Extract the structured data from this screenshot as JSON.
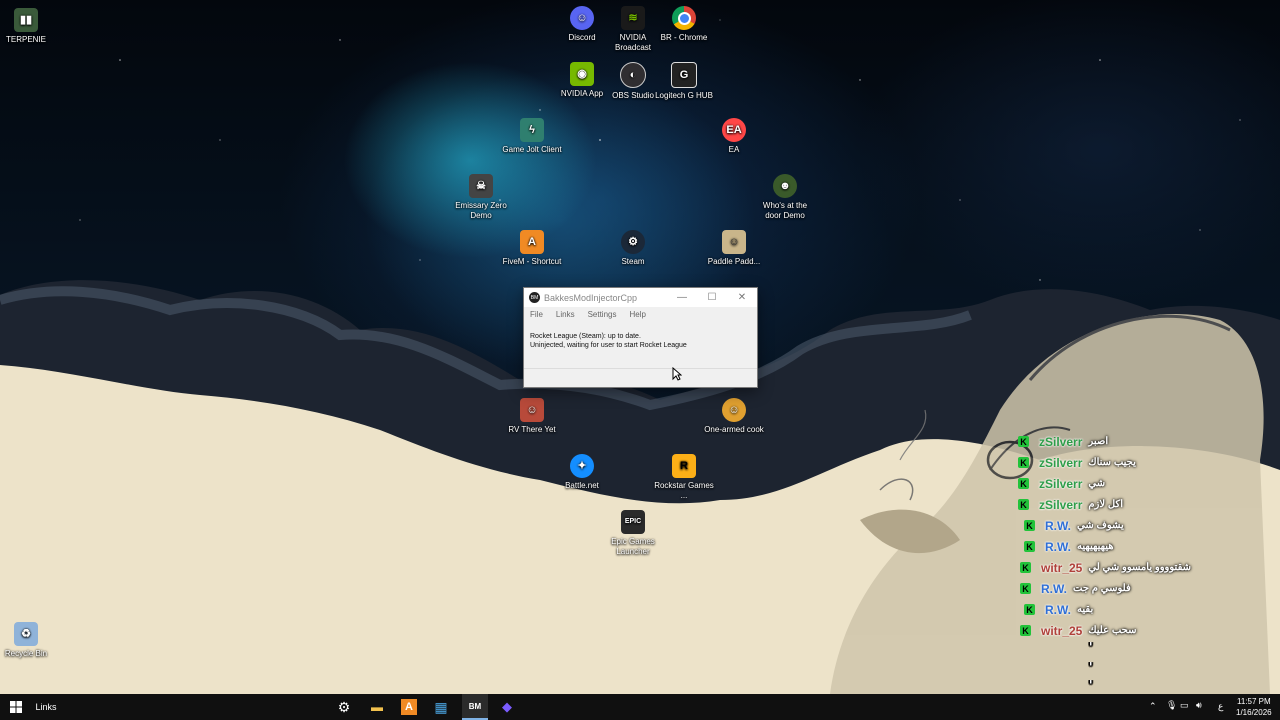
{
  "desktop": {
    "icons": [
      {
        "label": "TERPENIE",
        "icon": "folder-icon",
        "color": "#3a5a3a"
      },
      {
        "label": "Discord",
        "icon": "discord-icon",
        "color": "#5865f2"
      },
      {
        "label": "NVIDIA Broadcast",
        "icon": "nvidia-broadcast-icon",
        "color": "#1a1a1a"
      },
      {
        "label": "BR - Chrome",
        "icon": "chrome-icon",
        "color": "#db4437"
      },
      {
        "label": "NVIDIA App",
        "icon": "nvidia-icon",
        "color": "#76b900"
      },
      {
        "label": "OBS Studio",
        "icon": "obs-icon",
        "color": "#302e31"
      },
      {
        "label": "Logitech G HUB",
        "icon": "logitech-icon",
        "color": "#222222"
      },
      {
        "label": "Game Jolt Client",
        "icon": "gamejolt-icon",
        "color": "#2f7f6f"
      },
      {
        "label": "EA",
        "icon": "ea-icon",
        "color": "#ff4747"
      },
      {
        "label": "Emissary Zero Demo",
        "icon": "emissary-icon",
        "color": "#444444"
      },
      {
        "label": "Who's at the door Demo",
        "icon": "whos-at-door-icon",
        "color": "#3a5a2a"
      },
      {
        "label": "FiveM - Shortcut",
        "icon": "fivem-icon",
        "color": "#f08a24"
      },
      {
        "label": "Steam",
        "icon": "steam-icon",
        "color": "#1b2838"
      },
      {
        "label": "Paddle Padd...",
        "icon": "paddle-icon",
        "color": "#c9b58a"
      },
      {
        "label": "RV There Yet",
        "icon": "rv-there-yet-icon",
        "color": "#b84a3a"
      },
      {
        "label": "One-armed cook",
        "icon": "one-armed-cook-icon",
        "color": "#e0a030"
      },
      {
        "label": "Battle.net",
        "icon": "battlenet-icon",
        "color": "#148eff"
      },
      {
        "label": "Rockstar Games ...",
        "icon": "rockstar-icon",
        "color": "#fcaf17"
      },
      {
        "label": "Epic Games Launcher",
        "icon": "epic-games-icon",
        "color": "#2a2a2a"
      },
      {
        "label": "Recycle Bin",
        "icon": "recycle-bin-icon",
        "color": "#8fb3d9"
      }
    ]
  },
  "window": {
    "title": "BakkesModInjectorCpp",
    "minimize": "—",
    "maximize": "☐",
    "close": "✕",
    "menu": [
      "File",
      "Links",
      "Settings",
      "Help"
    ],
    "status_line1": "Rocket League (Steam): up to date.",
    "status_line2": "Uninjected, waiting for user to start Rocket League"
  },
  "chat": {
    "badge": "K",
    "messages": [
      {
        "user": "zSilverr",
        "text": "اصبر",
        "color": "#2e9e4a"
      },
      {
        "user": "zSilverr",
        "text": "يجيب سناك",
        "color": "#2e9e4a"
      },
      {
        "user": "zSilverr",
        "text": "شي",
        "color": "#2e9e4a"
      },
      {
        "user": "zSilverr",
        "text": "اكل لازم",
        "color": "#2e9e4a"
      },
      {
        "user": "R.W.",
        "text": "يشوف شي",
        "color": "#2f6fd6"
      },
      {
        "user": "R.W.",
        "text": "هيهيهيهيه",
        "color": "#2f6fd6"
      },
      {
        "user": "witr_25",
        "text": "شقتوووو يامسوو شي لي",
        "color": "#b0403a"
      },
      {
        "user": "R.W.",
        "text": "فلوسي م جت",
        "color": "#2f6fd6"
      },
      {
        "user": "R.W.",
        "text": "بقيه",
        "color": "#2f6fd6"
      },
      {
        "user": "witr_25",
        "text": "سحب عليك",
        "color": "#b0403a"
      }
    ],
    "ticks": "ٰٰٰٰٰٰٰٰٰٰٰٰٰٰٰٰٰٰٰٰٰٰٰٰٰٰٰٰٰٰٰٰٰٰٰٰ"
  },
  "taskbar": {
    "links_label": "Links",
    "pinned": [
      {
        "name": "settings-taskbar-button",
        "icon": "gear-icon",
        "glyph": "⚙",
        "color": "#ffffff"
      },
      {
        "name": "file-explorer-taskbar-button",
        "icon": "folder-icon",
        "glyph": "▬",
        "color": "#f2c14e"
      },
      {
        "name": "fivem-taskbar-button",
        "icon": "fivem-icon",
        "glyph": "A",
        "color": "#f08a24"
      },
      {
        "name": "microsoft-store-taskbar-button",
        "icon": "store-icon",
        "glyph": "▦",
        "color": "#4aa3df"
      },
      {
        "name": "bakkesmod-taskbar-button",
        "icon": "bakkesmod-icon",
        "glyph": "BM",
        "color": "#ffffff"
      },
      {
        "name": "app-taskbar-button",
        "icon": "arrow-app-icon",
        "glyph": "◆",
        "color": "#7b5cff"
      }
    ],
    "lang": "ع",
    "time": "11:57 PM",
    "date": "1/16/2026"
  }
}
